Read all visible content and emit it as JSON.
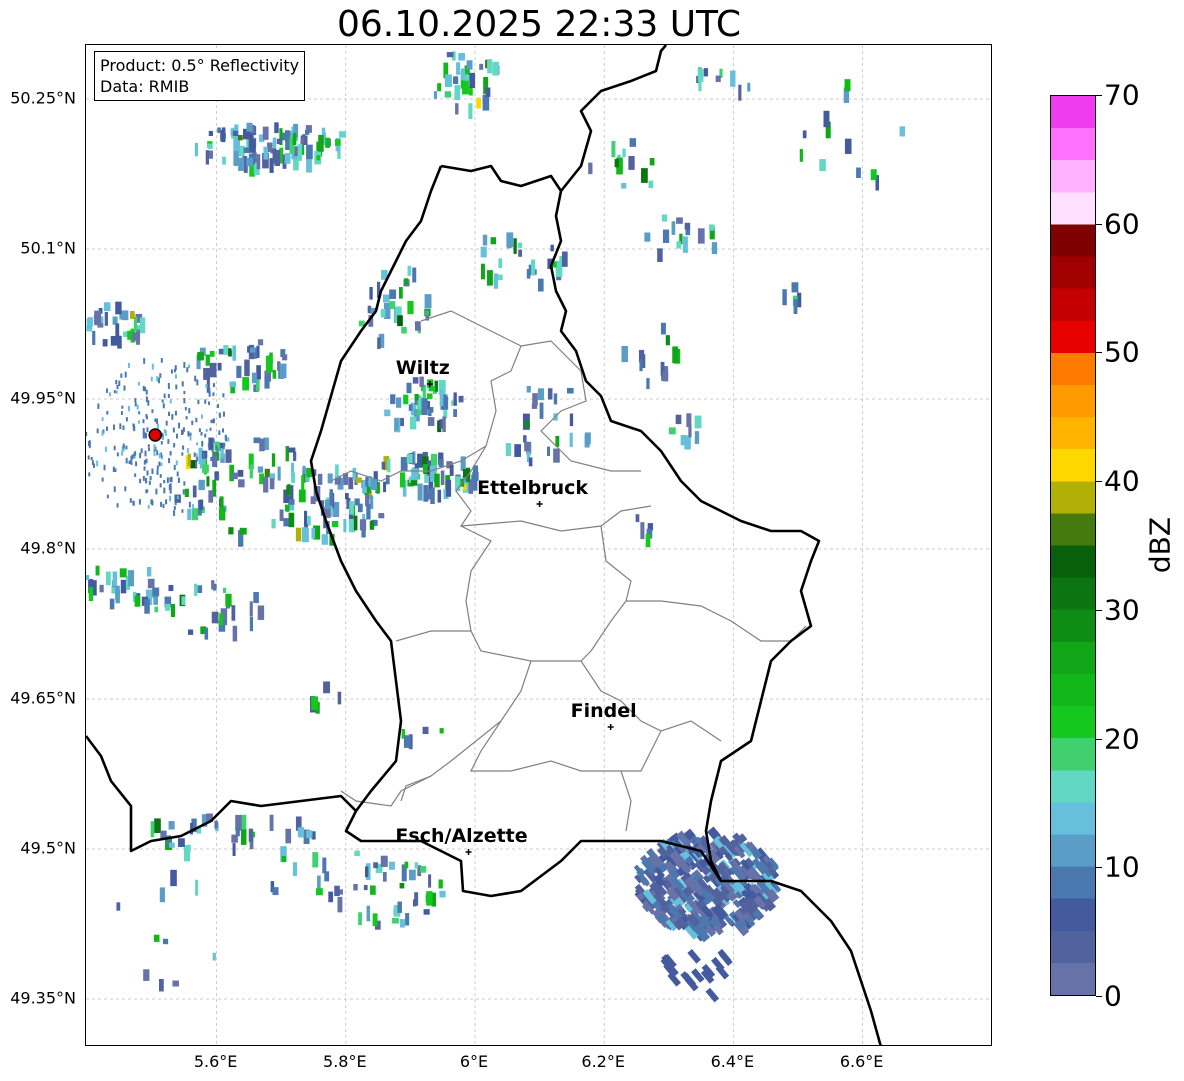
{
  "title": "06.10.2025 22:33 UTC",
  "info_box": {
    "product": "Product: 0.5° Reflectivity",
    "data": "Data: RMIB"
  },
  "lat_labels": [
    "50.25°N",
    "50.1°N",
    "49.95°N",
    "49.8°N",
    "49.65°N",
    "49.5°N",
    "49.35°N"
  ],
  "lon_labels": [
    "5.6°E",
    "5.8°E",
    "6°E",
    "6.2°E",
    "6.4°E",
    "6.6°E"
  ],
  "colorbar": {
    "label": "dBZ",
    "ticks": [
      "0",
      "10",
      "20",
      "30",
      "40",
      "50",
      "60",
      "70"
    ],
    "colors": [
      "#6672a8",
      "#52629e",
      "#445a9e",
      "#4c78b0",
      "#5a9ec8",
      "#66c0dc",
      "#62d8c4",
      "#40d070",
      "#14c81e",
      "#12b81a",
      "#10a618",
      "#0e8c14",
      "#0c7410",
      "#08600c",
      "#447a0e",
      "#b0b006",
      "#ffd800",
      "#ffb400",
      "#ff9a00",
      "#ff7a00",
      "#e80000",
      "#c40000",
      "#a00000",
      "#7e0000",
      "#ffe0ff",
      "#ffb2ff",
      "#ff70ff",
      "#ee3cee"
    ]
  },
  "cities": [
    {
      "name": "Wiltz",
      "lon": 5.93,
      "lat": 49.965
    },
    {
      "name": "Ettelbruck",
      "lon": 6.1,
      "lat": 49.845
    },
    {
      "name": "Findel",
      "lon": 6.21,
      "lat": 49.622
    },
    {
      "name": "Esch/Alzette",
      "lon": 5.99,
      "lat": 49.497
    }
  ],
  "radar_site": {
    "lon": 5.505,
    "lat": 49.914
  },
  "colors": {
    "border": "#000000",
    "admin": "#808080",
    "radar_site": "#e00000"
  }
}
